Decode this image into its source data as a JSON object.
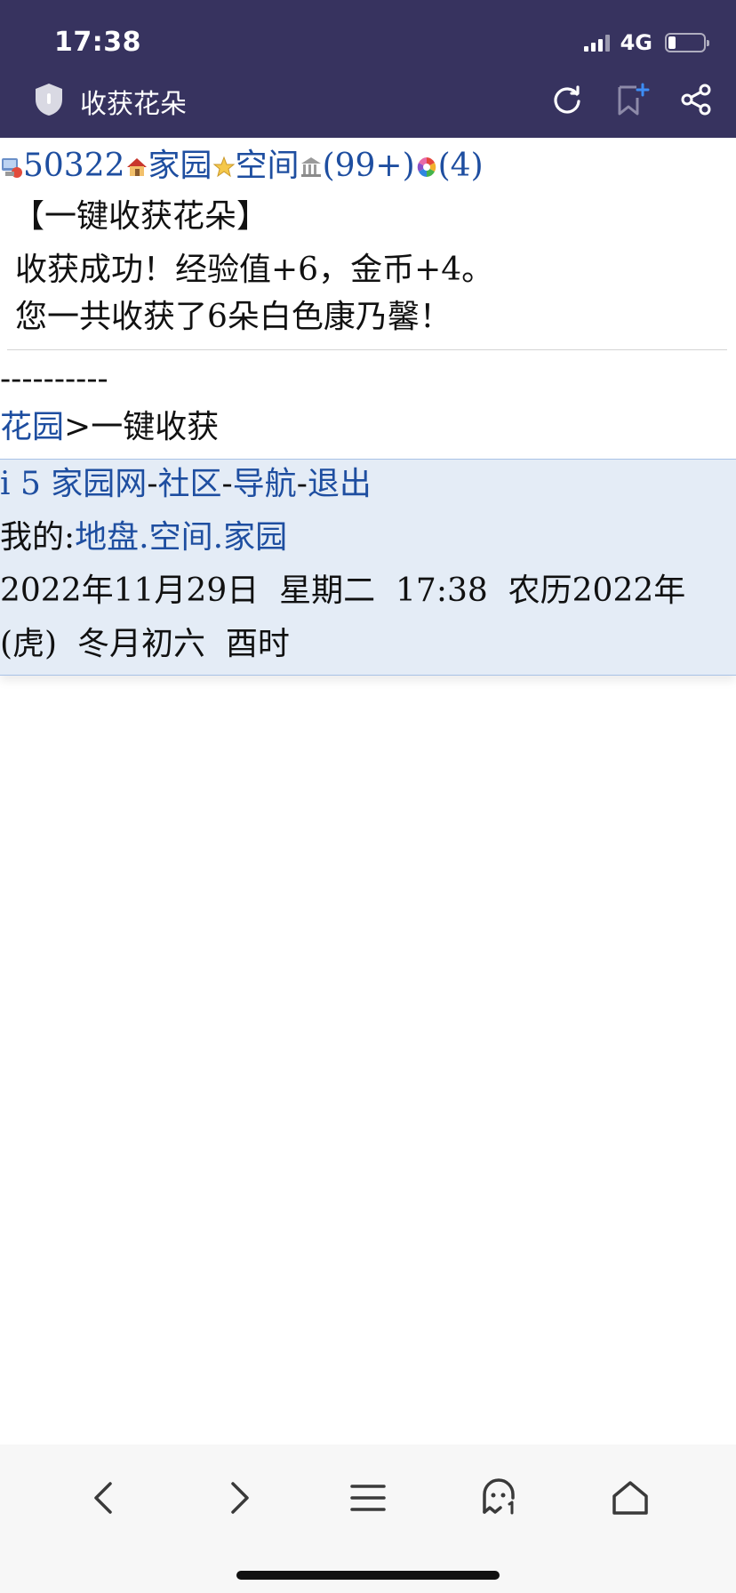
{
  "status": {
    "time": "17:38",
    "network": "4G"
  },
  "titlebar": {
    "title": "收获花朵"
  },
  "nav_row": {
    "user_id": "50322",
    "home_link": "家园",
    "space_link": "空间",
    "mail_count": "(99+)",
    "notice_count": "(4)"
  },
  "result": {
    "heading": "【一键收获花朵】",
    "message_line1": "收获成功！经验值+6，金币+4。",
    "message_line2": "您一共收获了6朵白色康乃馨！"
  },
  "separator_text": "----------",
  "breadcrumb": {
    "garden_link": "花园",
    "sep": ">",
    "current": "一键收获"
  },
  "footer": {
    "site_link": "i 5 家园网",
    "dash1": "-",
    "community_link": "社区",
    "dash2": "-",
    "nav_link": "导航",
    "dash3": "-",
    "logout_link": "退出",
    "mine_label": "我的:",
    "land_link": "地盘",
    "dot1": ".",
    "space_link": "空间",
    "dot2": ".",
    "home_link": "家园",
    "date_line1": "2022年11月29日  星期二  17:38  农历2022年",
    "date_line2": "(虎)  冬月初六  酉时"
  },
  "icons": {
    "shield": "shield-icon",
    "refresh": "refresh-icon",
    "bookmark": "bookmark-add-icon",
    "share": "share-icon",
    "back": "back-icon",
    "forward": "forward-icon",
    "menu": "menu-icon",
    "ghost": "ghost-icon",
    "home": "home-icon"
  }
}
